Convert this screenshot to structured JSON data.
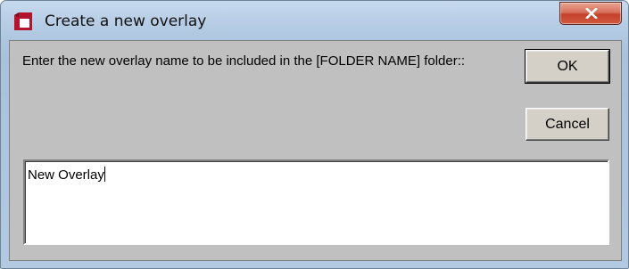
{
  "dialog": {
    "title": "Create a new overlay",
    "prompt": "Enter the new overlay name to be included in the [FOLDER NAME] folder::",
    "ok_label": "OK",
    "cancel_label": "Cancel",
    "name_value": "New Overlay"
  },
  "icons": {
    "app": "overlay-app-icon",
    "close": "close-icon"
  },
  "colors": {
    "icon_red": "#b3142d",
    "close_red": "#c4412b",
    "frame_blue": "#b4cbe4",
    "client_gray": "#c0c0c0"
  }
}
